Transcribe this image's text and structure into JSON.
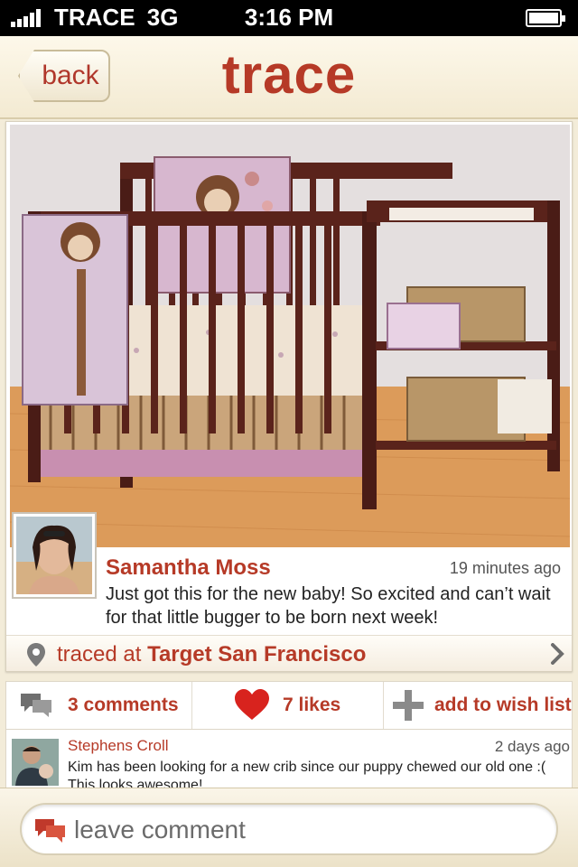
{
  "status_bar": {
    "carrier": "TRACE",
    "network": "3G",
    "time": "3:16 PM"
  },
  "nav": {
    "back_label": "back",
    "title": "trace"
  },
  "post": {
    "author": "Samantha Moss",
    "time": "19 minutes ago",
    "text": "Just got this for the new baby!  So excited and can’t wait for that little bugger to be born next week!",
    "location_prefix": "traced at",
    "location_name": "Target San Francisco"
  },
  "actions": {
    "comments_label": "3 comments",
    "likes_label": "7 likes",
    "wishlist_label": "add to wish list"
  },
  "comment": {
    "author": "Stephens Croll",
    "time": "2 days ago",
    "text": "Kim has been looking for a new crib since our puppy chewed our old one :(   This looks awesome!"
  },
  "compose": {
    "placeholder": "leave comment"
  },
  "colors": {
    "accent": "#b63a27",
    "background": "#f3ecd9"
  }
}
